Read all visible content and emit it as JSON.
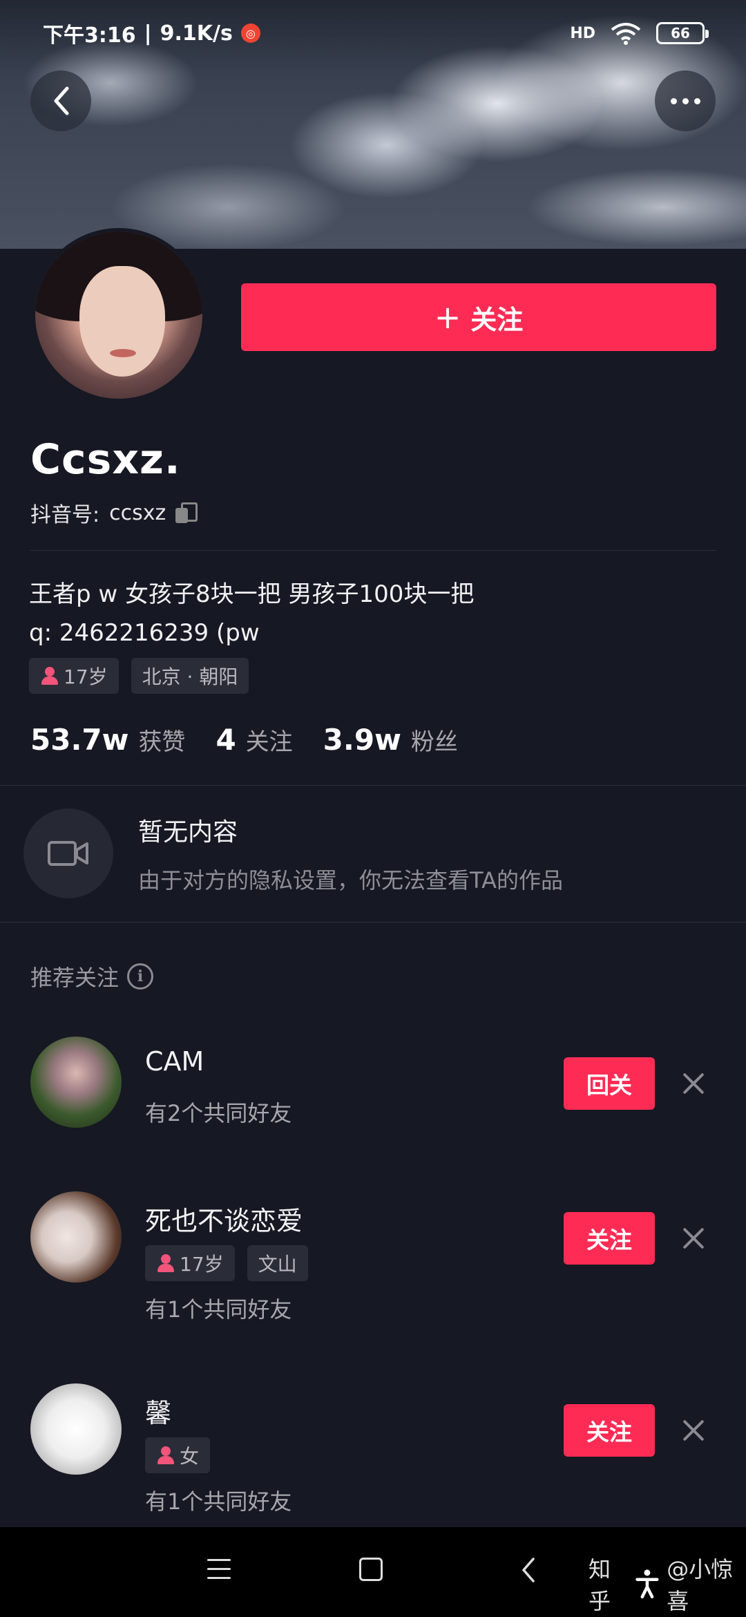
{
  "status_bar": {
    "time": "下午3:16",
    "separator": "|",
    "speed": "9.1K/s",
    "signal": "HD",
    "battery": "66"
  },
  "profile": {
    "follow_label": "关注",
    "follow_plus": "+",
    "name": "Ccsxz.",
    "uid_label": "抖音号:",
    "uid_value": "ccsxz",
    "bio_line1": "王者p w 女孩子8块一把 男孩子100块一把",
    "bio_line2": "q: 2462216239 (pw",
    "tags": {
      "age": "17岁",
      "location": "北京 · 朝阳"
    },
    "stats": {
      "likes_num": "53.7w",
      "likes_label": "获赞",
      "following_num": "4",
      "following_label": "关注",
      "fans_num": "3.9w",
      "fans_label": "粉丝"
    }
  },
  "empty_state": {
    "title": "暂无内容",
    "subtitle": "由于对方的隐私设置，你无法查看TA的作品"
  },
  "recommend": {
    "header": "推荐关注",
    "info_glyph": "i",
    "items": [
      {
        "name": "CAM",
        "button": "回关",
        "friends": "有2个共同好友"
      },
      {
        "name": "死也不谈恋爱",
        "tag_age": "17岁",
        "tag_loc": "文山",
        "button": "关注",
        "friends": "有1个共同好友"
      },
      {
        "name": "馨",
        "tag_gender": "女",
        "button": "关注",
        "friends": "有1个共同好友"
      }
    ]
  },
  "watermark": {
    "site": "知乎",
    "author": "@小惊喜"
  },
  "colors": {
    "accent": "#fe2c55",
    "background": "#161823"
  }
}
